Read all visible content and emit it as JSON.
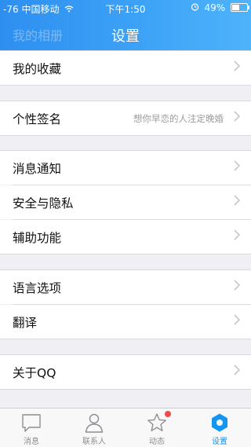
{
  "status_bar": {
    "signal": "-76",
    "carrier": "中国移动",
    "time": "下午1:50",
    "battery_pct": "49%",
    "battery_level": 0.49
  },
  "header": {
    "back_label": "我的相册",
    "title": "设置"
  },
  "settings": {
    "favorites": {
      "label": "我的收藏"
    },
    "signature": {
      "label": "个性签名",
      "value": "想你早恋的人注定晚婚"
    },
    "notifications": {
      "label": "消息通知"
    },
    "privacy": {
      "label": "安全与隐私"
    },
    "accessibility": {
      "label": "辅助功能"
    },
    "language": {
      "label": "语言选项"
    },
    "translate": {
      "label": "翻译"
    },
    "about": {
      "label": "关于QQ"
    }
  },
  "tabbar": {
    "messages": {
      "label": "消息",
      "icon": "chat-bubble-icon"
    },
    "contacts": {
      "label": "联系人",
      "icon": "person-icon"
    },
    "moments": {
      "label": "动态",
      "icon": "star-icon"
    },
    "settings": {
      "label": "设置",
      "icon": "gear-icon"
    }
  },
  "colors": {
    "accent": "#1296f0",
    "badge": "#f04b4b",
    "header_start": "#2e8ff0",
    "header_end": "#4fb3fb"
  }
}
